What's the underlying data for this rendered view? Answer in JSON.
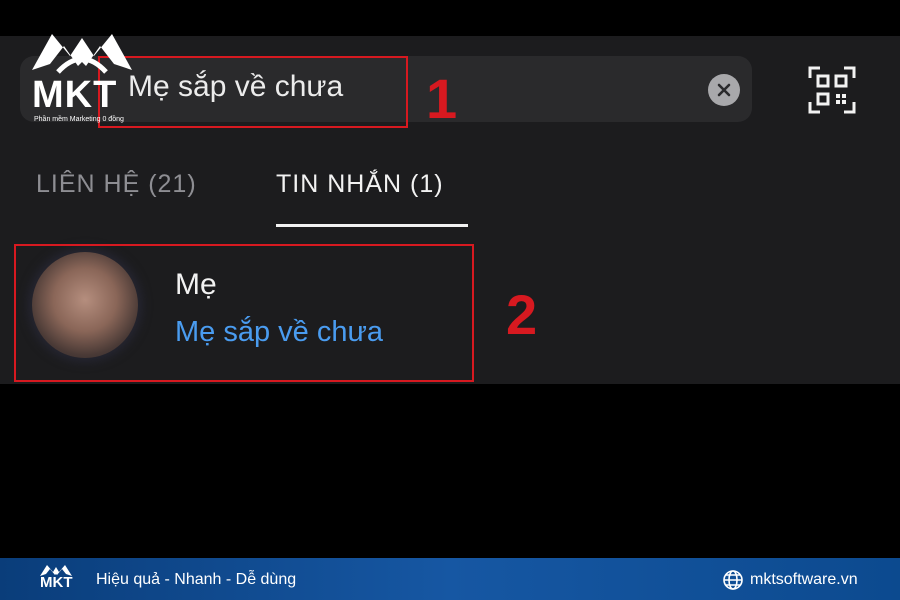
{
  "search": {
    "query": "Mẹ sắp về chưa"
  },
  "tabs": [
    {
      "label": "LIÊN HỆ (21)",
      "active": false
    },
    {
      "label": "TIN NHẮN (1)",
      "active": true
    }
  ],
  "result": {
    "name": "Mẹ",
    "message": "Mẹ sắp về chưa"
  },
  "annotations": {
    "step1": "1",
    "step2": "2"
  },
  "logo": {
    "text": "MKT",
    "tagline": "Phần mềm Marketing 0 đồng"
  },
  "footer": {
    "logo_text": "MKT",
    "slogan": "Hiệu quả - Nhanh - Dễ dùng",
    "website": "mktsoftware.vn"
  },
  "colors": {
    "annotation": "#d71920",
    "link": "#4a9cf0",
    "footer": "#1657a3"
  },
  "icons": [
    "clear-icon",
    "qr-code-icon",
    "globe-icon"
  ]
}
